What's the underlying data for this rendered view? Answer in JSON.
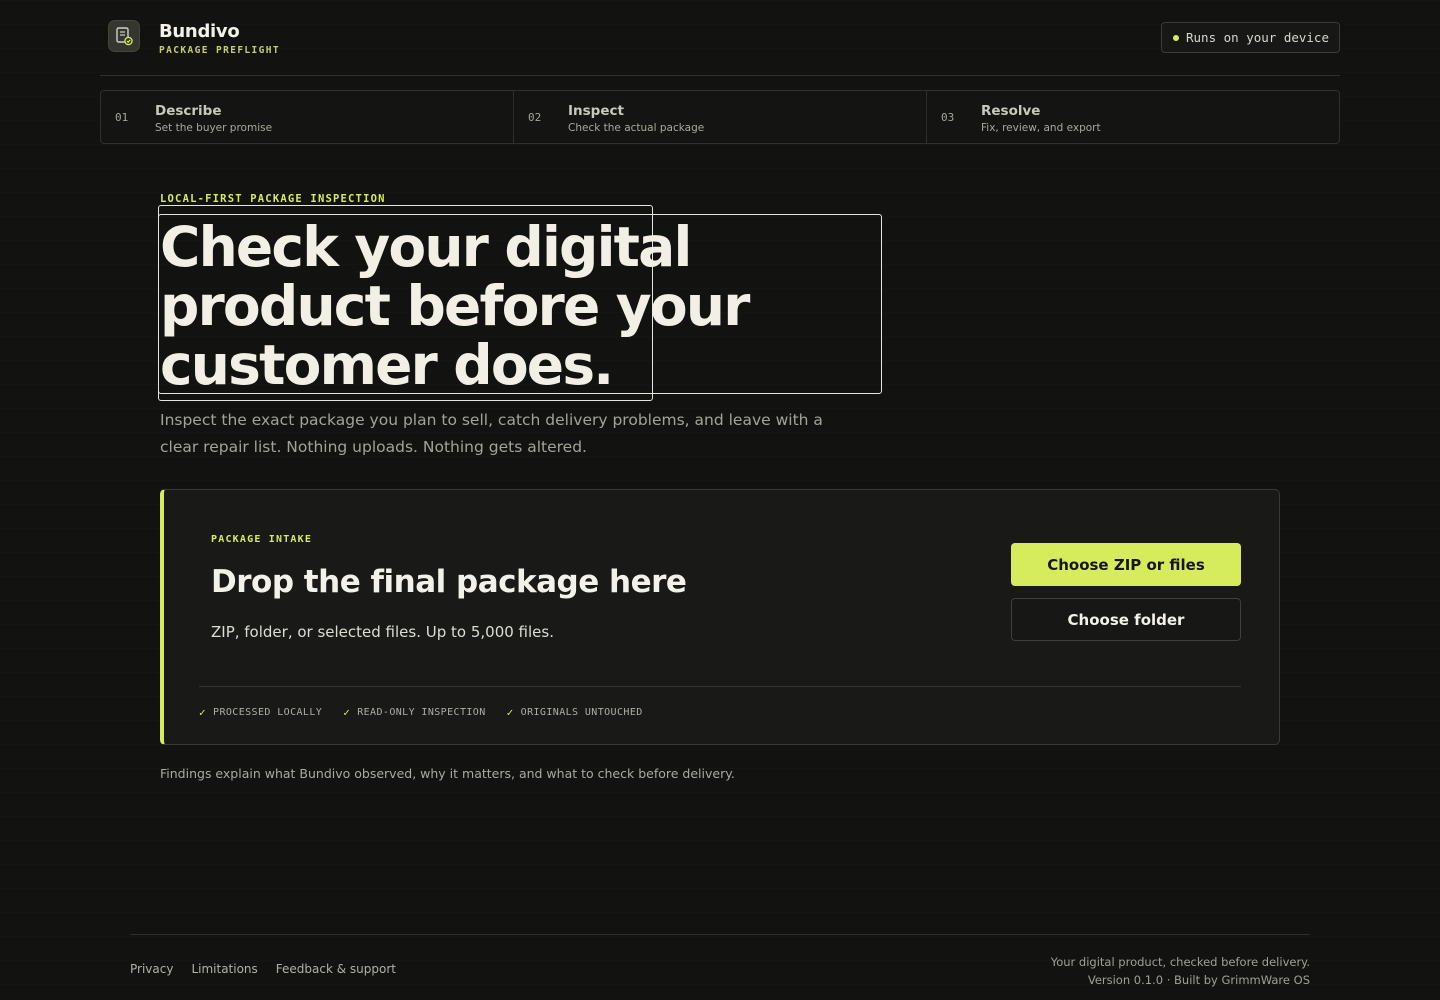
{
  "header": {
    "brand_name": "Bundivo",
    "brand_sub": "PACKAGE PREFLIGHT",
    "device_badge": "Runs on your device",
    "logo_icon": "document-check-icon"
  },
  "steps": [
    {
      "num": "01",
      "title": "Describe",
      "sub": "Set the buyer promise"
    },
    {
      "num": "02",
      "title": "Inspect",
      "sub": "Check the actual package"
    },
    {
      "num": "03",
      "title": "Resolve",
      "sub": "Fix, review, and export"
    }
  ],
  "hero": {
    "eyebrow": "LOCAL-FIRST PACKAGE INSPECTION",
    "title_line1": "Check your digital",
    "title_line2": "product before your",
    "title_line3": "customer does.",
    "description": "Inspect the exact package you plan to sell, catch delivery problems, and leave with a clear repair list. Nothing uploads. Nothing gets altered."
  },
  "intake": {
    "eyebrow": "PACKAGE INTAKE",
    "title": "Drop the final package here",
    "description": "ZIP, folder, or selected files. Up to 5,000 files.",
    "primary_button": "Choose ZIP or files",
    "secondary_button": "Choose folder",
    "features": [
      "PROCESSED LOCALLY",
      "READ-ONLY INSPECTION",
      "ORIGINALS UNTOUCHED"
    ]
  },
  "findings_note": "Findings explain what Bundivo observed, why it matters, and what to check before delivery.",
  "footer": {
    "links": [
      "Privacy",
      "Limitations",
      "Feedback & support"
    ],
    "tagline": "Your digital product, checked before delivery.",
    "version": "Version 0.1.0 · Built by GrimmWare OS"
  },
  "colors": {
    "accent": "#d6ec5c",
    "background": "#121311",
    "card": "#191a17"
  }
}
